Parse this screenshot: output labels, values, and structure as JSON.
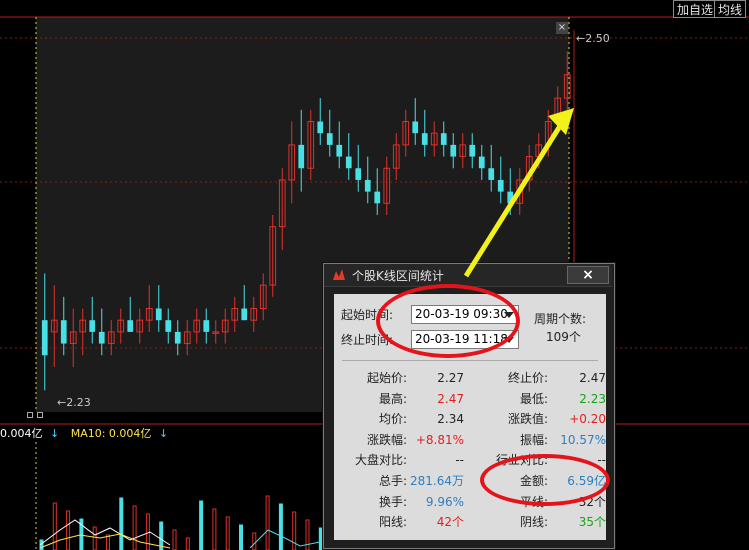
{
  "toolbar": {
    "add_watch": "加自选",
    "ma_line": "均线"
  },
  "chart": {
    "price_high": "2.50",
    "price_low": "2.23",
    "close_glyph": "×",
    "ma_indicators": [
      {
        "label": "0.004亿",
        "arrow": "↓",
        "color": "#ffffff"
      },
      {
        "label": "MA10: 0.004亿",
        "arrow": "↓",
        "color": "#ffe54a"
      }
    ]
  },
  "dialog": {
    "title": "个股K线区间统计",
    "close_label": "×",
    "start_label": "起始时间:",
    "start_value": "20-03-19 09:30",
    "end_label": "终止时间:",
    "end_value": "20-03-19 11:18",
    "period_label": "周期个数:",
    "period_value": "109个",
    "stats": [
      {
        "l1": "起始价:",
        "v1": "2.27",
        "c1": "black",
        "l2": "终止价:",
        "v2": "2.47",
        "c2": "black"
      },
      {
        "l1": "最高:",
        "v1": "2.47",
        "c1": "red",
        "l2": "最低:",
        "v2": "2.23",
        "c2": "green"
      },
      {
        "l1": "均价:",
        "v1": "2.34",
        "c1": "black",
        "l2": "涨跌值:",
        "v2": "+0.20",
        "c2": "red"
      },
      {
        "l1": "涨跌幅:",
        "v1": "+8.81%",
        "c1": "red",
        "l2": "振幅:",
        "v2": "10.57%",
        "c2": "blue"
      },
      {
        "l1": "大盘对比:",
        "v1": "--",
        "c1": "black",
        "l2": "行业对比:",
        "v2": "--",
        "c2": "black"
      },
      {
        "l1": "总手:",
        "v1": "281.64万",
        "c1": "blue",
        "l2": "金额:",
        "v2": "6.59亿",
        "c2": "blue"
      },
      {
        "l1": "换手:",
        "v1": "9.96%",
        "c1": "blue",
        "l2": "平线:",
        "v2": "32个",
        "c2": "black"
      },
      {
        "l1": "阳线:",
        "v1": "42个",
        "c1": "red",
        "l2": "阴线:",
        "v2": "35个",
        "c2": "green"
      }
    ]
  },
  "colors": {
    "up": "#e0302a",
    "down": "#48e0e4",
    "grid": "#8b1a1a",
    "arrow": "#f2f21a",
    "highlight": "#e5141b"
  },
  "chart_data": {
    "type": "candlestick",
    "ylim": [
      2.2,
      2.52
    ],
    "candles": [
      [
        2.27,
        2.31,
        2.21,
        2.24
      ],
      [
        2.26,
        2.3,
        2.23,
        2.27
      ],
      [
        2.27,
        2.29,
        2.24,
        2.25
      ],
      [
        2.25,
        2.28,
        2.23,
        2.26
      ],
      [
        2.26,
        2.28,
        2.24,
        2.27
      ],
      [
        2.27,
        2.29,
        2.25,
        2.26
      ],
      [
        2.26,
        2.28,
        2.24,
        2.25
      ],
      [
        2.25,
        2.27,
        2.24,
        2.26
      ],
      [
        2.26,
        2.28,
        2.25,
        2.27
      ],
      [
        2.27,
        2.29,
        2.26,
        2.26
      ],
      [
        2.26,
        2.28,
        2.25,
        2.27
      ],
      [
        2.27,
        2.3,
        2.26,
        2.28
      ],
      [
        2.28,
        2.3,
        2.26,
        2.27
      ],
      [
        2.27,
        2.28,
        2.25,
        2.26
      ],
      [
        2.26,
        2.27,
        2.24,
        2.25
      ],
      [
        2.25,
        2.27,
        2.24,
        2.26
      ],
      [
        2.26,
        2.28,
        2.25,
        2.27
      ],
      [
        2.27,
        2.28,
        2.25,
        2.26
      ],
      [
        2.26,
        2.27,
        2.25,
        2.26
      ],
      [
        2.26,
        2.28,
        2.25,
        2.27
      ],
      [
        2.27,
        2.29,
        2.26,
        2.28
      ],
      [
        2.28,
        2.3,
        2.27,
        2.27
      ],
      [
        2.27,
        2.29,
        2.26,
        2.28
      ],
      [
        2.28,
        2.31,
        2.27,
        2.3
      ],
      [
        2.3,
        2.36,
        2.29,
        2.35
      ],
      [
        2.35,
        2.4,
        2.33,
        2.39
      ],
      [
        2.39,
        2.44,
        2.37,
        2.42
      ],
      [
        2.42,
        2.45,
        2.38,
        2.4
      ],
      [
        2.4,
        2.45,
        2.39,
        2.44
      ],
      [
        2.44,
        2.46,
        2.42,
        2.43
      ],
      [
        2.43,
        2.45,
        2.41,
        2.42
      ],
      [
        2.42,
        2.44,
        2.4,
        2.41
      ],
      [
        2.41,
        2.43,
        2.39,
        2.4
      ],
      [
        2.4,
        2.42,
        2.38,
        2.39
      ],
      [
        2.39,
        2.41,
        2.37,
        2.38
      ],
      [
        2.38,
        2.4,
        2.36,
        2.37
      ],
      [
        2.37,
        2.41,
        2.36,
        2.4
      ],
      [
        2.4,
        2.43,
        2.39,
        2.42
      ],
      [
        2.42,
        2.45,
        2.41,
        2.44
      ],
      [
        2.44,
        2.46,
        2.42,
        2.43
      ],
      [
        2.43,
        2.45,
        2.41,
        2.42
      ],
      [
        2.42,
        2.44,
        2.41,
        2.43
      ],
      [
        2.43,
        2.44,
        2.41,
        2.42
      ],
      [
        2.42,
        2.43,
        2.4,
        2.41
      ],
      [
        2.41,
        2.43,
        2.4,
        2.42
      ],
      [
        2.42,
        2.43,
        2.4,
        2.41
      ],
      [
        2.41,
        2.42,
        2.39,
        2.4
      ],
      [
        2.4,
        2.42,
        2.38,
        2.39
      ],
      [
        2.39,
        2.41,
        2.37,
        2.38
      ],
      [
        2.38,
        2.4,
        2.36,
        2.37
      ],
      [
        2.37,
        2.4,
        2.36,
        2.39
      ],
      [
        2.39,
        2.42,
        2.38,
        2.41
      ],
      [
        2.41,
        2.43,
        2.4,
        2.42
      ],
      [
        2.42,
        2.45,
        2.41,
        2.44
      ],
      [
        2.44,
        2.47,
        2.43,
        2.46
      ],
      [
        2.46,
        2.5,
        2.45,
        2.48
      ]
    ]
  }
}
